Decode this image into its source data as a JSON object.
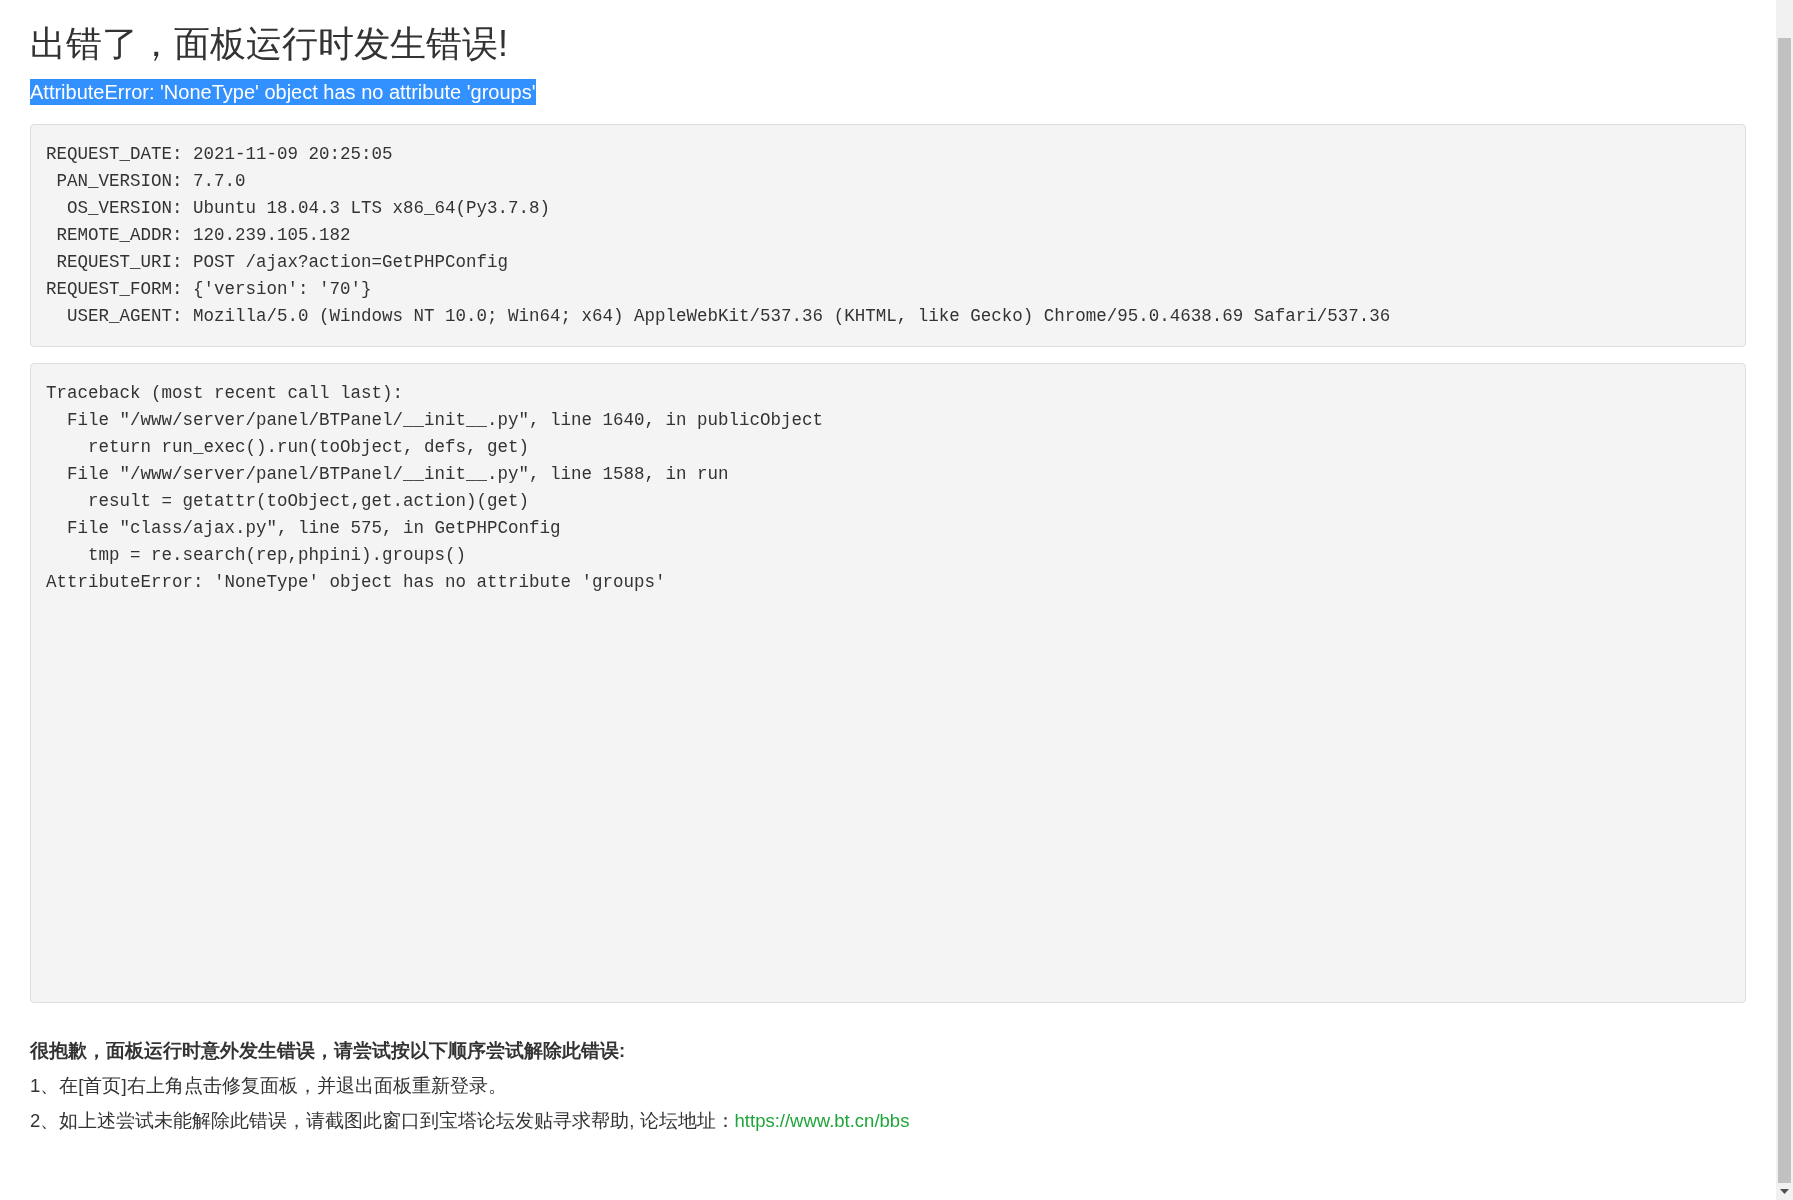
{
  "title": "出错了，面板运行时发生错误!",
  "error_message": {
    "text": "AttributeError: 'NoneType' object has no attribute 'groups'",
    "selected": true
  },
  "request_info": [
    "REQUEST_DATE: 2021-11-09 20:25:05",
    " PAN_VERSION: 7.7.0",
    "  OS_VERSION: Ubuntu 18.04.3 LTS x86_64(Py3.7.8)",
    " REMOTE_ADDR: 120.239.105.182",
    " REQUEST_URI: POST /ajax?action=GetPHPConfig",
    "REQUEST_FORM: {'version': '70'}",
    "  USER_AGENT: Mozilla/5.0 (Windows NT 10.0; Win64; x64) AppleWebKit/537.36 (KHTML, like Gecko) Chrome/95.0.4638.69 Safari/537.36"
  ],
  "traceback": [
    "Traceback (most recent call last):",
    "  File \"/www/server/panel/BTPanel/__init__.py\", line 1640, in publicObject",
    "    return run_exec().run(toObject, defs, get)",
    "  File \"/www/server/panel/BTPanel/__init__.py\", line 1588, in run",
    "    result = getattr(toObject,get.action)(get)",
    "  File \"class/ajax.py\", line 575, in GetPHPConfig",
    "    tmp = re.search(rep,phpini).groups()",
    "AttributeError: 'NoneType' object has no attribute 'groups'"
  ],
  "help": {
    "heading": "很抱歉，面板运行时意外发生错误，请尝试按以下顺序尝试解除此错误:",
    "steps": [
      {
        "text": "1、在[首页]右上角点击修复面板，并退出面板重新登录。"
      },
      {
        "text": "2、如上述尝试未能解除此错误，请截图此窗口到宝塔论坛发贴寻求帮助, 论坛地址：",
        "link": "https://www.bt.cn/bbs"
      }
    ]
  }
}
